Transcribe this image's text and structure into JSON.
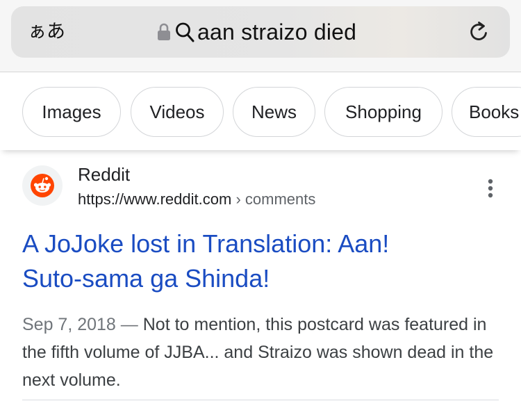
{
  "browser": {
    "aa_label": "ぁあ",
    "url_text": "aan straizo died"
  },
  "chips": [
    {
      "label": "Images"
    },
    {
      "label": "Videos"
    },
    {
      "label": "News"
    },
    {
      "label": "Shopping"
    },
    {
      "label": "Books"
    }
  ],
  "result": {
    "source_name": "Reddit",
    "source_url": "https://www.reddit.com",
    "breadcrumb": "› comments",
    "title_line1": "A JoJoke lost in Translation: Aan!",
    "title_line2": "Suto-sama ga Shinda!",
    "date": "Sep 7, 2018",
    "separator": "—",
    "snippet": "Not to mention, this postcard was featured in the fifth volume of JJBA... and Straizo was shown dead in the next volume."
  },
  "colors": {
    "link": "#1a4cc2",
    "reddit": "#ff4500"
  },
  "icons": [
    "lock-icon",
    "search-icon",
    "reload-icon",
    "reddit-logo-icon",
    "more-vert-icon"
  ]
}
